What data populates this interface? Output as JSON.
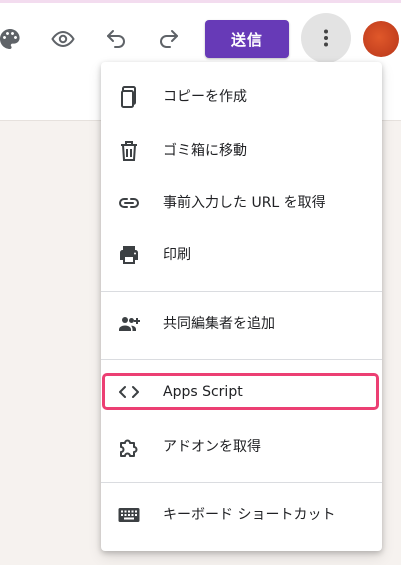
{
  "toolbar": {
    "icons": [
      "palette-icon",
      "preview-eye-icon",
      "undo-icon",
      "redo-icon"
    ],
    "send_label": "送信",
    "send_color": "#673ab7",
    "more_icon": "more-vert-icon"
  },
  "menu": {
    "items": [
      {
        "label": "コピーを作成",
        "icon": "copy-icon"
      },
      {
        "label": "ゴミ箱に移動",
        "icon": "trash-icon"
      },
      {
        "label": "事前入力した URL を取得",
        "icon": "link-icon"
      },
      {
        "label": "印刷",
        "icon": "print-icon"
      },
      {
        "label": "共同編集者を追加",
        "icon": "add-people-icon"
      },
      {
        "label": "Apps Script",
        "icon": "code-icon"
      },
      {
        "label": "アドオンを取得",
        "icon": "puzzle-icon"
      },
      {
        "label": "キーボード ショートカット",
        "icon": "keyboard-icon"
      }
    ],
    "highlight_color": "#ec3f73"
  }
}
